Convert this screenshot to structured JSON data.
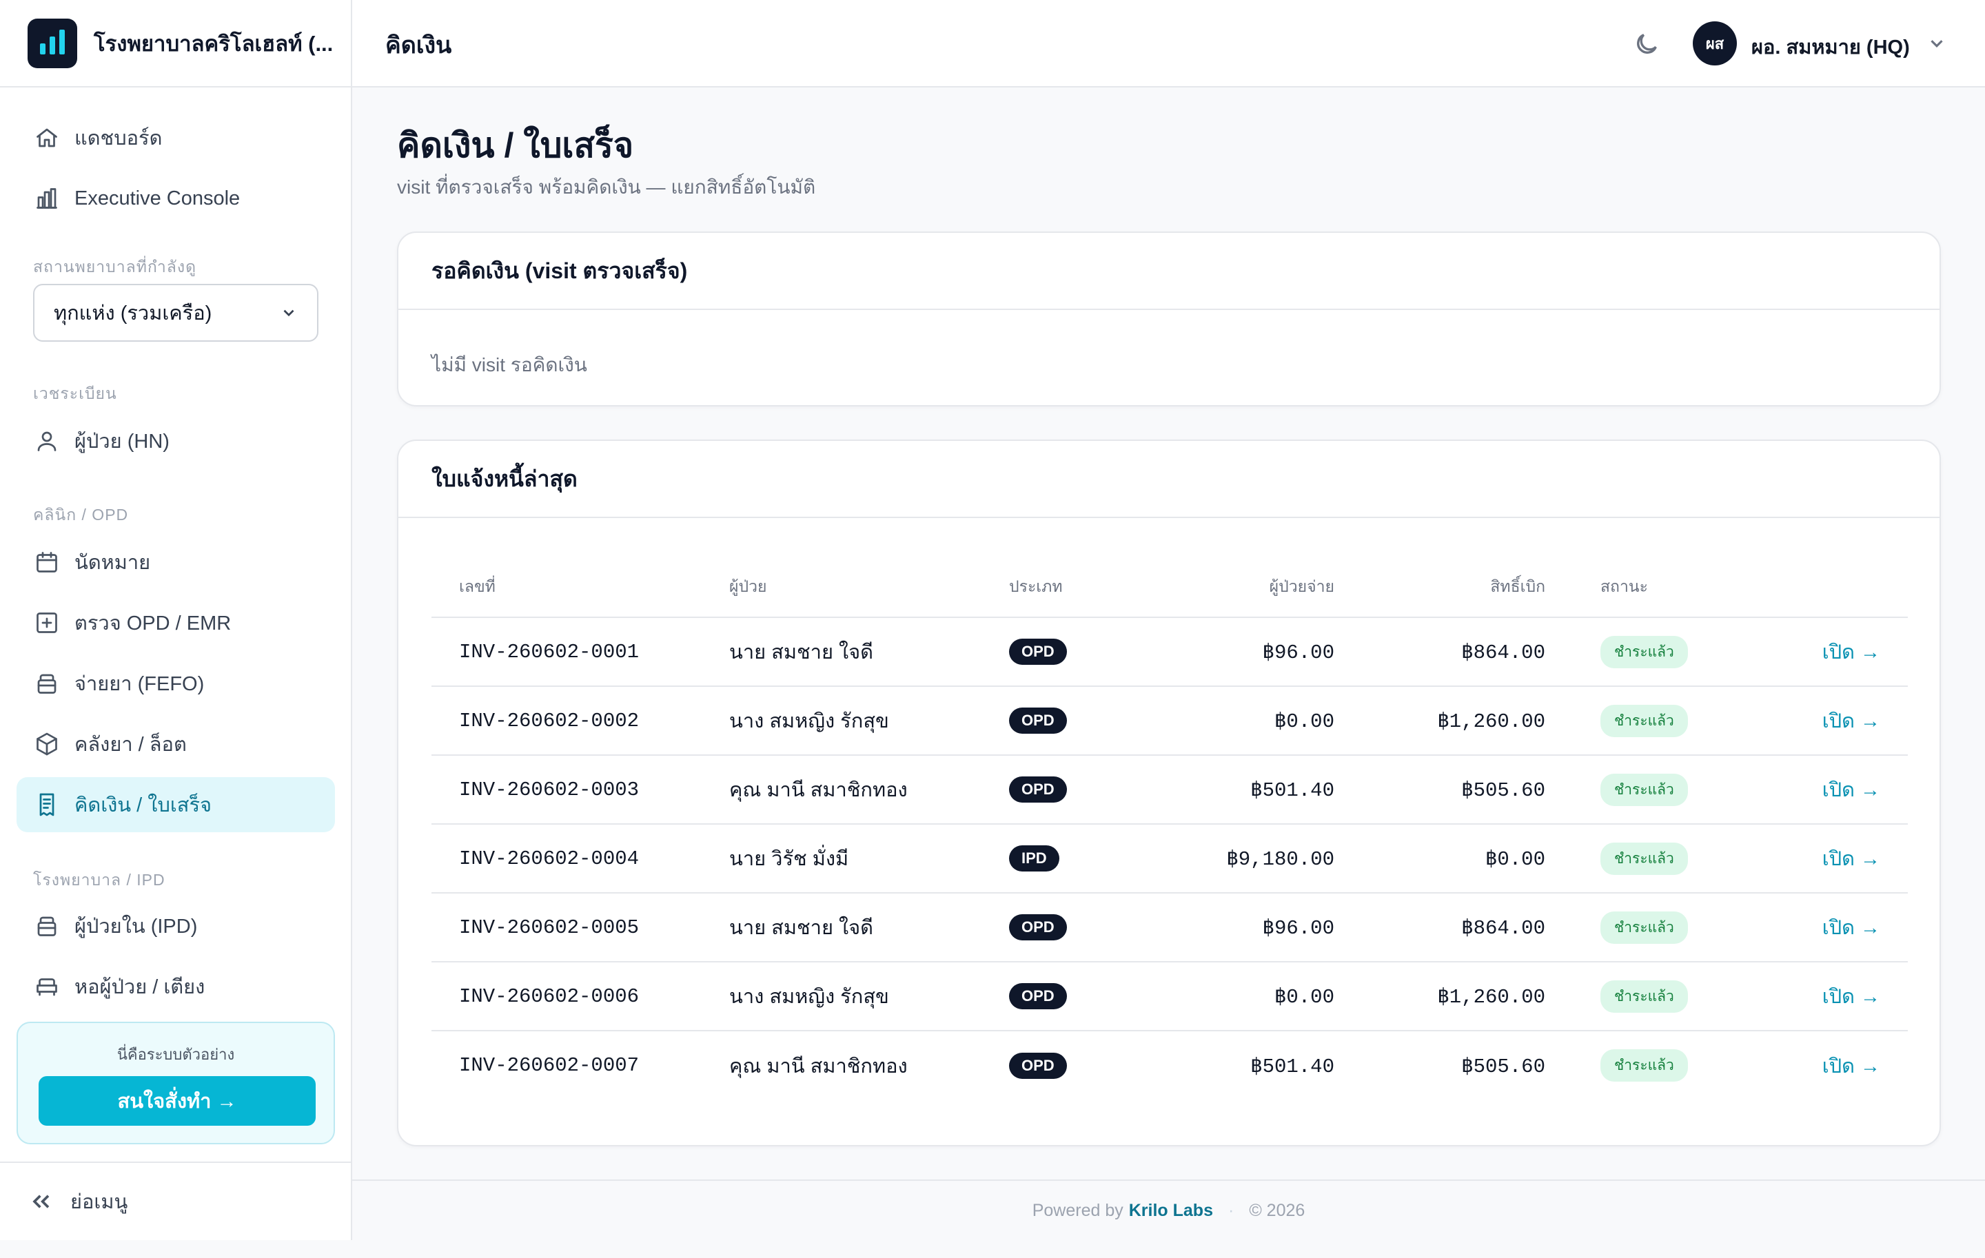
{
  "sidebar": {
    "brand": "โรงพยาบาลคริโลเฮลท์ (...",
    "items": {
      "dashboard": "แดชบอร์ด",
      "executive": "Executive Console",
      "patients": "ผู้ป่วย (HN)",
      "appointments": "นัดหมาย",
      "opd": "ตรวจ OPD / EMR",
      "dispense": "จ่ายยา (FEFO)",
      "inventory": "คลังยา / ล็อต",
      "billing": "คิดเงิน / ใบเสร็จ",
      "ipd": "ผู้ป่วยใน (IPD)",
      "ward": "หอผู้ป่วย / เตียง"
    },
    "sections": {
      "facility": "สถานพยาบาลที่กำลังดู",
      "records": "เวชระเบียน",
      "clinic": "คลินิก / OPD",
      "hospital": "โรงพยาบาล / IPD"
    },
    "facility_select": "ทุกแห่ง (รวมเครือ)",
    "promo_text": "นี่คือระบบตัวอย่าง",
    "promo_button": "สนใจสั่งทำ →",
    "collapse": "ย่อเมนู"
  },
  "header": {
    "title": "คิดเงิน",
    "avatar_initials": "ผส",
    "user_name": "ผอ. สมหมาย (HQ)"
  },
  "main": {
    "title": "คิดเงิน / ใบเสร็จ",
    "subtitle": "visit ที่ตรวจเสร็จ พร้อมคิดเงิน — แยกสิทธิ์อัตโนมัติ",
    "pending_card": {
      "title": "รอคิดเงิน (visit ตรวจเสร็จ)",
      "empty": "ไม่มี visit รอคิดเงิน"
    },
    "invoices_card": {
      "title": "ใบแจ้งหนี้ล่าสุด",
      "headers": {
        "number": "เลขที่",
        "patient": "ผู้ป่วย",
        "type": "ประเภท",
        "patient_pay": "ผู้ป่วยจ่าย",
        "claim": "สิทธิ์เบิก",
        "status": "สถานะ"
      },
      "rows": [
        {
          "number": "INV-260602-0001",
          "patient": "นาย สมชาย ใจดี",
          "type": "OPD",
          "patient_pay": "฿96.00",
          "claim": "฿864.00",
          "status": "ชำระแล้ว",
          "action": "เปิด →"
        },
        {
          "number": "INV-260602-0002",
          "patient": "นาง สมหญิง รักสุข",
          "type": "OPD",
          "patient_pay": "฿0.00",
          "claim": "฿1,260.00",
          "status": "ชำระแล้ว",
          "action": "เปิด →"
        },
        {
          "number": "INV-260602-0003",
          "patient": "คุณ มานี สมาชิกทอง",
          "type": "OPD",
          "patient_pay": "฿501.40",
          "claim": "฿505.60",
          "status": "ชำระแล้ว",
          "action": "เปิด →"
        },
        {
          "number": "INV-260602-0004",
          "patient": "นาย วิรัช มั่งมี",
          "type": "IPD",
          "patient_pay": "฿9,180.00",
          "claim": "฿0.00",
          "status": "ชำระแล้ว",
          "action": "เปิด →"
        },
        {
          "number": "INV-260602-0005",
          "patient": "นาย สมชาย ใจดี",
          "type": "OPD",
          "patient_pay": "฿96.00",
          "claim": "฿864.00",
          "status": "ชำระแล้ว",
          "action": "เปิด →"
        },
        {
          "number": "INV-260602-0006",
          "patient": "นาง สมหญิง รักสุข",
          "type": "OPD",
          "patient_pay": "฿0.00",
          "claim": "฿1,260.00",
          "status": "ชำระแล้ว",
          "action": "เปิด →"
        },
        {
          "number": "INV-260602-0007",
          "patient": "คุณ มานี สมาชิกทอง",
          "type": "OPD",
          "patient_pay": "฿501.40",
          "claim": "฿505.60",
          "status": "ชำระแล้ว",
          "action": "เปิด →"
        }
      ]
    }
  },
  "footer": {
    "powered": "Powered by",
    "brand": "Krilo Labs",
    "copyright": "© 2026"
  },
  "colors": {
    "accent": "#06b6d4",
    "dark": "#0f172a",
    "paid_bg": "#dcf7e9",
    "paid_text": "#15803d"
  }
}
